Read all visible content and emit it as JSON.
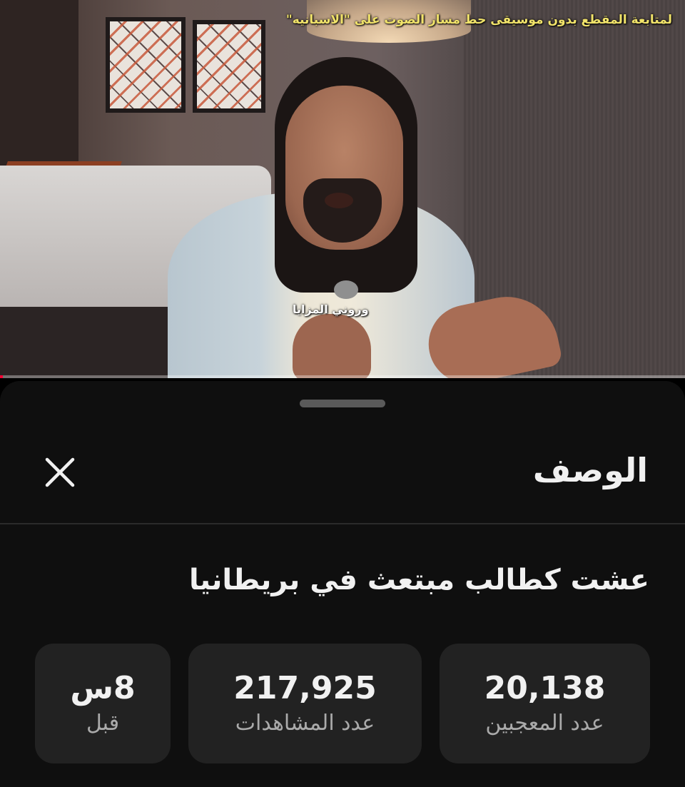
{
  "video": {
    "caption_top": "لمتابعة المقطع بدون موسيقى حط مسار الصوت على \"الاسبانيه\"",
    "subtitle": "وروني المزايا",
    "progress": 0.004,
    "progress_color": "#ff0033"
  },
  "sheet": {
    "title": "الوصف",
    "close_icon": "close-icon",
    "video_title": "عشت كطالب مبتعث في بريطانيا",
    "stats": {
      "likes": {
        "value": "20,138",
        "label": "عدد المعجبين"
      },
      "views": {
        "value": "217,925",
        "label": "عدد المشاهدات"
      },
      "time": {
        "value": "8س",
        "label": "قبل"
      }
    }
  }
}
